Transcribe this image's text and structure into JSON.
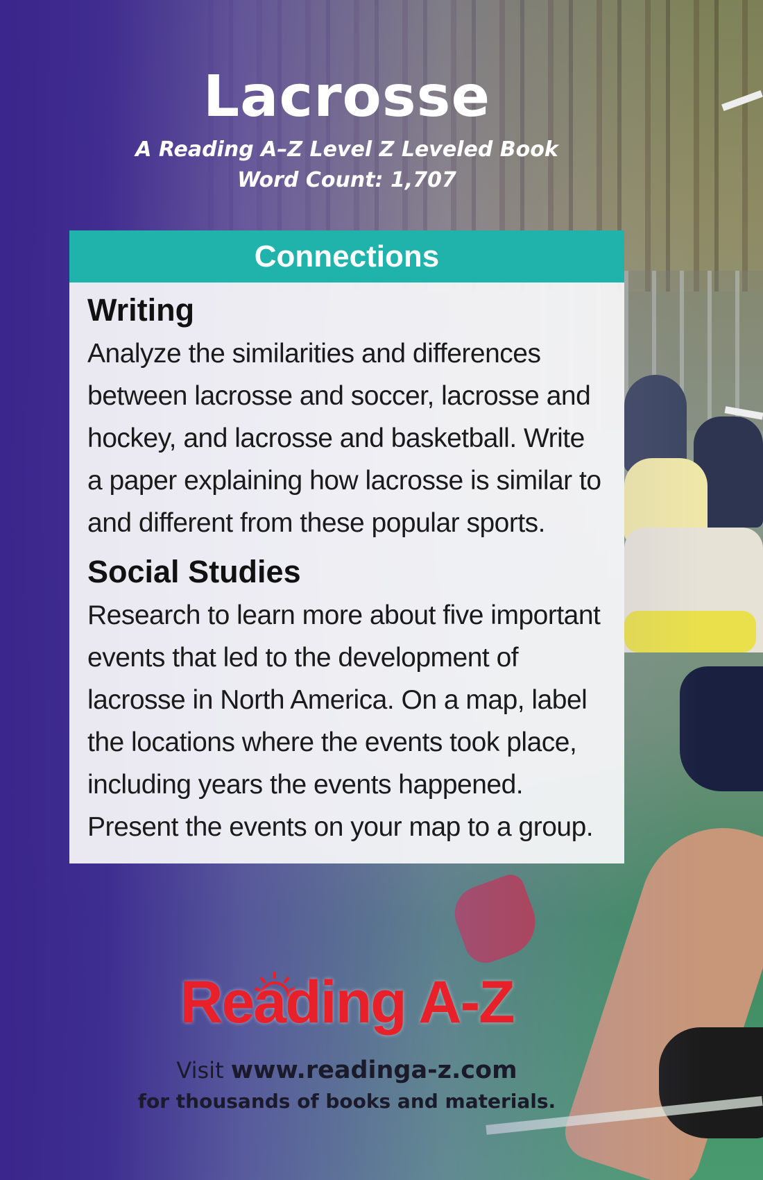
{
  "cover": {
    "title": "Lacrosse",
    "subtitle": "A Reading A–Z Level Z Leveled Book",
    "word_count": "Word Count: 1,707"
  },
  "connections": {
    "header": "Connections",
    "sections": [
      {
        "heading": "Writing",
        "body": "Analyze the similarities and differences between lacrosse and soccer, lacrosse and hockey, and lacrosse and basketball. Write a paper explaining how lacrosse is similar to and different from these popular sports."
      },
      {
        "heading": "Social Studies",
        "body": "Research to learn more about five important events that led to the development of lacrosse in North America. On a map, label the locations where the events took place, including years the events happened. Present the events on your map to a group."
      }
    ]
  },
  "footer": {
    "logo_text": "Reading A-Z",
    "visit_prefix": "Visit",
    "url": "www.readinga-z.com",
    "tagline": "for thousands of books and materials."
  },
  "colors": {
    "purple": "#3a268c",
    "teal_header": "#1fb3ab",
    "logo_red": "#e8202a"
  }
}
